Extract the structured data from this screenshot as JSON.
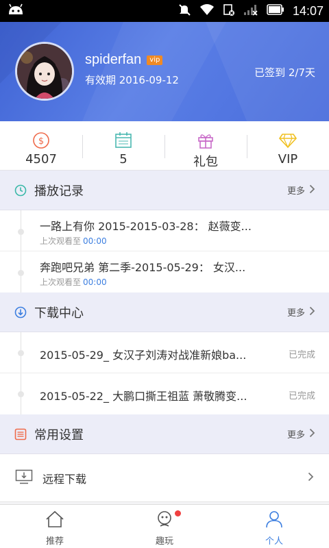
{
  "status_bar": {
    "time": "14:07"
  },
  "profile": {
    "username": "spiderfan",
    "vip_badge": "vip",
    "expiry": "有效期 2016-09-12",
    "checkin": "已签到 2/7天"
  },
  "stats": [
    {
      "icon": "coin-icon",
      "value": "4507"
    },
    {
      "icon": "calendar-icon",
      "value": "5"
    },
    {
      "icon": "gift-icon",
      "value": "礼包"
    },
    {
      "icon": "diamond-icon",
      "value": "VIP"
    }
  ],
  "play_history": {
    "title": "播放记录",
    "more": "更多",
    "items": [
      {
        "title": "一路上有你 2015-2015-03-28： 赵薇变...",
        "sub_prefix": "上次观看至",
        "time": "00:00"
      },
      {
        "title": "奔跑吧兄弟 第二季-2015-05-29： 女汉...",
        "sub_prefix": "上次观看至",
        "time": "00:00"
      }
    ]
  },
  "downloads": {
    "title": "下载中心",
    "more": "更多",
    "items": [
      {
        "title": "2015-05-29_ 女汉子刘涛对战准新娘ba...",
        "status": "已完成"
      },
      {
        "title": "2015-05-22_ 大鹏口撕王祖蓝 萧敬腾变...",
        "status": "已完成"
      }
    ]
  },
  "settings": {
    "title": "常用设置",
    "more": "更多",
    "items": [
      {
        "label": "远程下载"
      }
    ]
  },
  "tabs": [
    {
      "label": "推荐",
      "icon": "home-icon"
    },
    {
      "label": "趣玩",
      "icon": "fun-icon"
    },
    {
      "label": "个人",
      "icon": "person-icon"
    }
  ],
  "colors": {
    "accent": "#3d7fe0",
    "header": "#4a6ddc",
    "badge": "#f08a24"
  }
}
